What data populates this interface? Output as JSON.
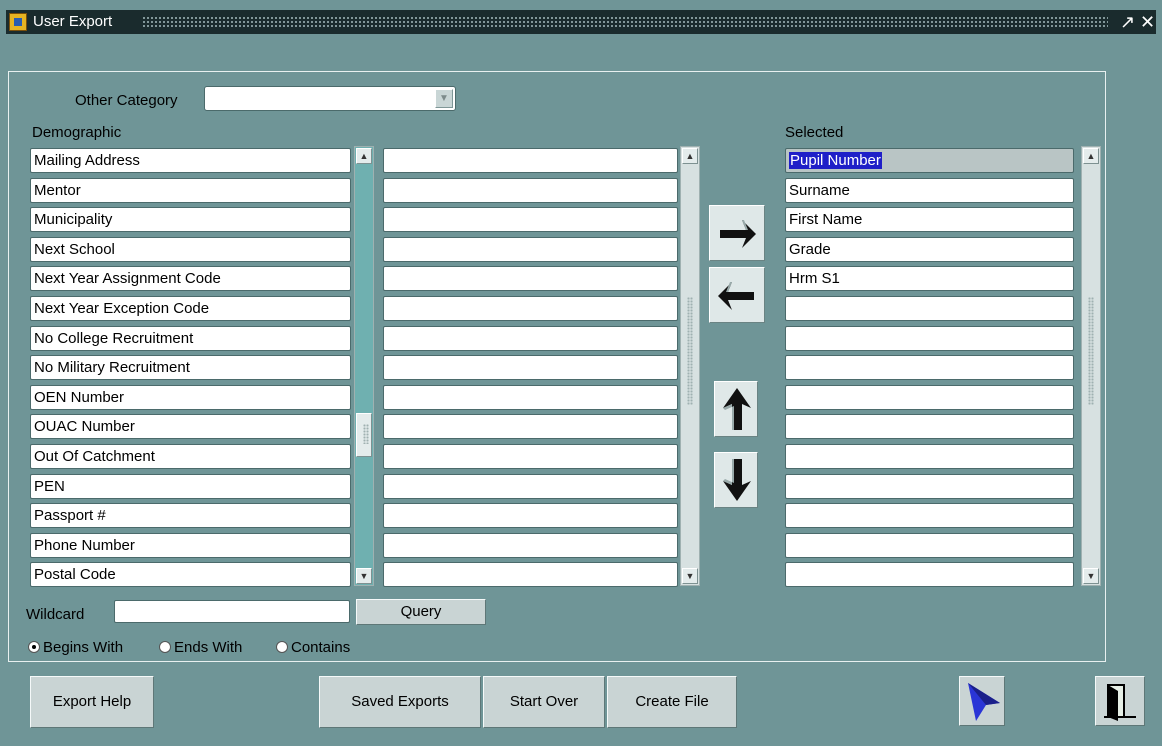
{
  "window": {
    "title": "User Export"
  },
  "form": {
    "other_category_label": "Other Category",
    "other_category_value": "",
    "demographic_label": "Demographic",
    "selected_label": "Selected",
    "demographic_items": [
      "Mailing Address",
      "Mentor",
      "Municipality",
      "Next School",
      "Next Year Assignment Code",
      "Next Year Exception Code",
      "No College Recruitment",
      "No Military Recruitment",
      "OEN Number",
      "OUAC Number",
      "Out Of Catchment",
      "PEN",
      "Passport #",
      "Phone Number",
      "Postal Code"
    ],
    "second_column_items": [
      "",
      "",
      "",
      "",
      "",
      "",
      "",
      "",
      "",
      "",
      "",
      "",
      "",
      "",
      ""
    ],
    "selected_items": [
      "Pupil Number",
      "Surname",
      "First Name",
      "Grade",
      "Hrm S1",
      "",
      "",
      "",
      "",
      "",
      "",
      "",
      "",
      "",
      ""
    ],
    "wildcard_label": "Wildcard",
    "wildcard_value": "",
    "query_label": "Query",
    "radio": {
      "begins_with": "Begins With",
      "ends_with": "Ends With",
      "contains": "Contains",
      "selected": "begins_with"
    }
  },
  "buttons": {
    "export_help": "Export Help",
    "saved_exports": "Saved Exports",
    "start_over": "Start Over",
    "create_file": "Create File"
  },
  "icons": {
    "move_right": "right-arrow-icon",
    "move_left": "left-arrow-icon",
    "move_up": "up-arrow-icon",
    "move_down": "down-arrow-icon",
    "cursor": "cursor-arrow-icon",
    "exit": "exit-door-icon"
  },
  "colors": {
    "background": "#6f9597",
    "selection": "#1f1fc8"
  }
}
